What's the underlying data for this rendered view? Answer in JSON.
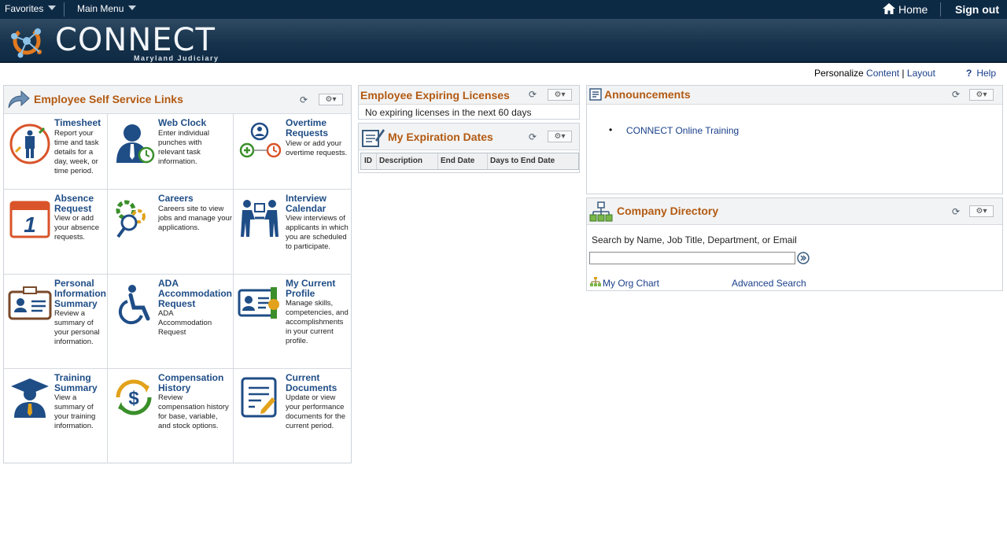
{
  "topnav": {
    "favorites": "Favorites",
    "main_menu": "Main Menu",
    "home": "Home",
    "signout": "Sign out"
  },
  "banner": {
    "brand": "CONNECT",
    "sub": "Maryland Judiciary"
  },
  "personalize": {
    "prefix": "Personalize",
    "content": "Content",
    "sep": "|",
    "layout": "Layout",
    "help": "Help"
  },
  "ess": {
    "title": "Employee Self Service Links",
    "tiles": [
      {
        "name": "Timesheet",
        "desc": "Report your time and task details for a day, week, or time period."
      },
      {
        "name": "Web Clock",
        "desc": "Enter individual punches with relevant task information."
      },
      {
        "name": "Overtime Requests",
        "desc": "View or add your overtime requests."
      },
      {
        "name": "Absence Request",
        "desc": "View or add your absence requests."
      },
      {
        "name": "Careers",
        "desc": "Careers site to view jobs and manage your applications."
      },
      {
        "name": "Interview Calendar",
        "desc": "View interviews of applicants in which you are scheduled to participate."
      },
      {
        "name": "Personal Information Summary",
        "desc": "Review a summary of your personal information."
      },
      {
        "name": "ADA Accommodation Request",
        "desc": "ADA Accommodation Request"
      },
      {
        "name": "My Current Profile",
        "desc": "Manage skills, competencies, and accomplishments in your current profile."
      },
      {
        "name": "Training Summary",
        "desc": "View a summary of your training information."
      },
      {
        "name": "Compensation History",
        "desc": "Review compensation history for base, variable, and stock options."
      },
      {
        "name": "Current Documents",
        "desc": "Update or view your performance documents for the current period."
      }
    ]
  },
  "licenses": {
    "title": "Employee Expiring Licenses",
    "message": "No expiring licenses in the next 60 days"
  },
  "expiration": {
    "title": "My Expiration Dates",
    "columns": [
      "ID",
      "Description",
      "End Date",
      "Days to End Date"
    ]
  },
  "announcements": {
    "title": "Announcements",
    "items": [
      "CONNECT Online Training"
    ]
  },
  "directory": {
    "title": "Company Directory",
    "prompt": "Search by Name, Job Title, Department, or Email",
    "input_value": "",
    "org_chart": "My Org Chart",
    "advanced": "Advanced Search"
  },
  "colors": {
    "nav": "#0d2a45",
    "title_orange": "#b35a12",
    "link_blue": "#1a3f8a",
    "tile_blue": "#1f4d86"
  }
}
